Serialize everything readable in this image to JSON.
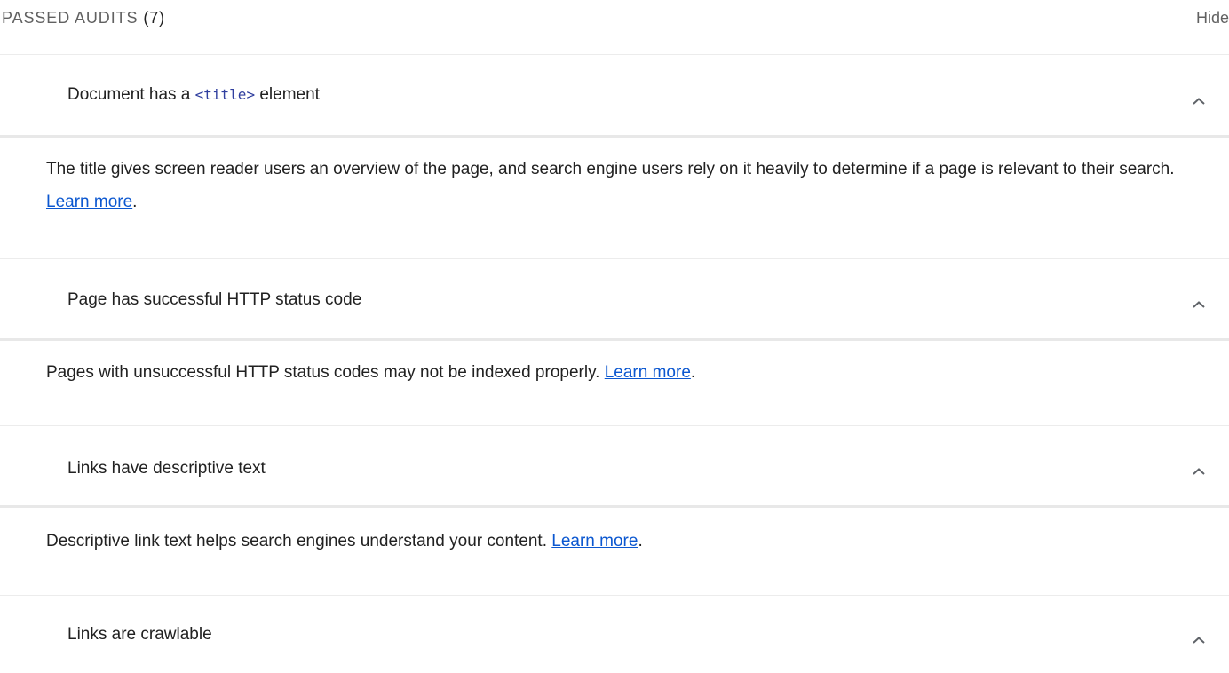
{
  "group": {
    "title": "PASSED AUDITS",
    "count": "(7)",
    "toggle_label": "Hide"
  },
  "audits": [
    {
      "title_before": "Document has a ",
      "title_code": "<title>",
      "title_after": " element",
      "description": "The title gives screen reader users an overview of the page, and search engine users rely on it heavily to determine if a page is relevant to their search. ",
      "link_text": "Learn more",
      "trailing": ".",
      "expanded": true,
      "chevron_icon": "chevron-up-icon"
    },
    {
      "title": "Page has successful HTTP status code",
      "description": "Pages with unsuccessful HTTP status codes may not be indexed properly. ",
      "link_text": "Learn more",
      "trailing": ".",
      "expanded": true,
      "chevron_icon": "chevron-up-icon"
    },
    {
      "title": "Links have descriptive text",
      "description": "Descriptive link text helps search engines understand your content. ",
      "link_text": "Learn more",
      "trailing": ".",
      "expanded": true,
      "chevron_icon": "chevron-up-icon"
    },
    {
      "title": "Links are crawlable",
      "expanded": true,
      "chevron_icon": "chevron-up-icon"
    }
  ],
  "colors": {
    "link": "#0b57d0",
    "code": "#303f9f",
    "muted_text": "#616161",
    "rule": "#e8e8e8"
  }
}
